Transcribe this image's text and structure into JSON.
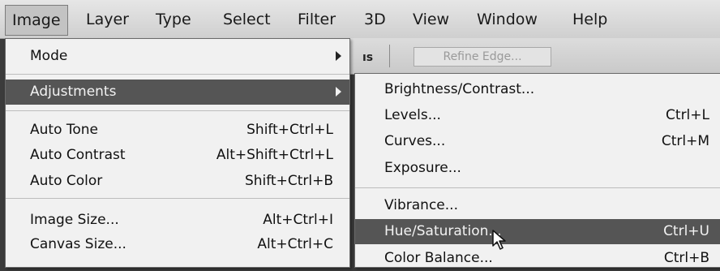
{
  "menubar": {
    "items": [
      "Image",
      "Layer",
      "Type",
      "Select",
      "Filter",
      "3D",
      "View",
      "Window",
      "Help"
    ]
  },
  "optionsbar": {
    "fragment": "ıs",
    "refine_edge": "Refine Edge..."
  },
  "image_menu": {
    "items": [
      {
        "label": "Mode",
        "submenu": true
      },
      {
        "label": "Adjustments",
        "submenu": true
      },
      {
        "label": "Auto Tone",
        "shortcut": "Shift+Ctrl+L"
      },
      {
        "label": "Auto Contrast",
        "shortcut": "Alt+Shift+Ctrl+L"
      },
      {
        "label": "Auto Color",
        "shortcut": "Shift+Ctrl+B"
      },
      {
        "label": "Image Size...",
        "shortcut": "Alt+Ctrl+I"
      },
      {
        "label": "Canvas Size...",
        "shortcut": "Alt+Ctrl+C"
      }
    ]
  },
  "adjustments_menu": {
    "items": [
      {
        "label": "Brightness/Contrast..."
      },
      {
        "label": "Levels...",
        "shortcut": "Ctrl+L"
      },
      {
        "label": "Curves...",
        "shortcut": "Ctrl+M"
      },
      {
        "label": "Exposure..."
      },
      {
        "label": "Vibrance..."
      },
      {
        "label": "Hue/Saturation...",
        "shortcut": "Ctrl+U"
      },
      {
        "label": "Color Balance...",
        "shortcut": "Ctrl+B"
      }
    ]
  },
  "icons": {
    "submenu_arrow": "submenu-arrow-icon",
    "cursor": "mouse-pointer-icon"
  }
}
